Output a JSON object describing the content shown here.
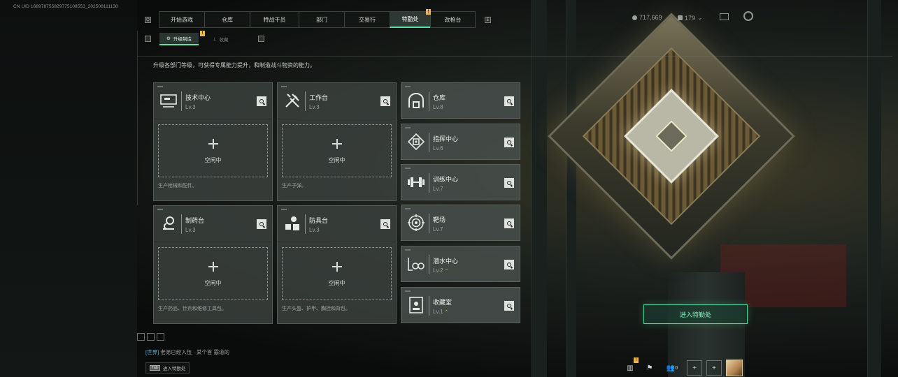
{
  "top": {
    "uid": "CN UID 168978755829775108553_202508111138",
    "tabs": [
      "开始游戏",
      "仓库",
      "特战干员",
      "部门",
      "交易行",
      "特勤处",
      "改枪台"
    ],
    "active_tab": "特勤处",
    "badge": "!",
    "currency_1": "717,669",
    "currency_2": "179",
    "mail_icon": "mail-icon",
    "settings_icon": "gear-icon"
  },
  "subtabs": {
    "items": [
      "升级制造",
      "收藏"
    ],
    "active": "升级制造",
    "badge": "!"
  },
  "description": "升级各部门等级，可获得专属能力提升，和制造战斗物资的能力。",
  "production_cards": [
    {
      "name": "技术中心",
      "level": "Lv.3",
      "icon": "computer-icon",
      "status": "空闲中",
      "footer": "生产枪械和配件。"
    },
    {
      "name": "工作台",
      "level": "Lv.3",
      "icon": "tools-icon",
      "status": "空闲中",
      "footer": "生产子弹。"
    },
    {
      "name": "制药台",
      "level": "Lv.3",
      "icon": "microscope-icon",
      "status": "空闲中",
      "footer": "生产药品、针剂和维修工具包。"
    },
    {
      "name": "防具台",
      "level": "Lv.3",
      "icon": "armor-icon",
      "status": "空闲中",
      "footer": "生产头盔、护甲、胸挂和背包。"
    }
  ],
  "facilities": [
    {
      "name": "仓库",
      "level": "Lv.8",
      "icon": "warehouse-icon",
      "upgrade": false
    },
    {
      "name": "指挥中心",
      "level": "Lv.6",
      "icon": "command-icon",
      "upgrade": false
    },
    {
      "name": "训练中心",
      "level": "Lv.7",
      "icon": "dumbbell-icon",
      "upgrade": false
    },
    {
      "name": "靶场",
      "level": "Lv.7",
      "icon": "target-icon",
      "upgrade": false
    },
    {
      "name": "潜水中心",
      "level": "Lv.2",
      "icon": "diving-icon",
      "upgrade": true
    },
    {
      "name": "收藏室",
      "level": "Lv.1",
      "icon": "collection-icon",
      "upgrade": true
    }
  ],
  "enter_button": "进入特勤处",
  "chat": {
    "channel": "[世界]",
    "message": "老弟已经入伍 · 某个首 霸道的"
  },
  "tab_hint": {
    "key": "Tab",
    "label": "进入特勤处"
  },
  "bottom_icons": [
    "chart-icon",
    "flag-icon",
    "friends-icon",
    "add-icon",
    "add-icon",
    "avatar"
  ],
  "friends_count": "0",
  "colors": {
    "accent": "#5ee2a0",
    "badge": "#e8b74a"
  }
}
